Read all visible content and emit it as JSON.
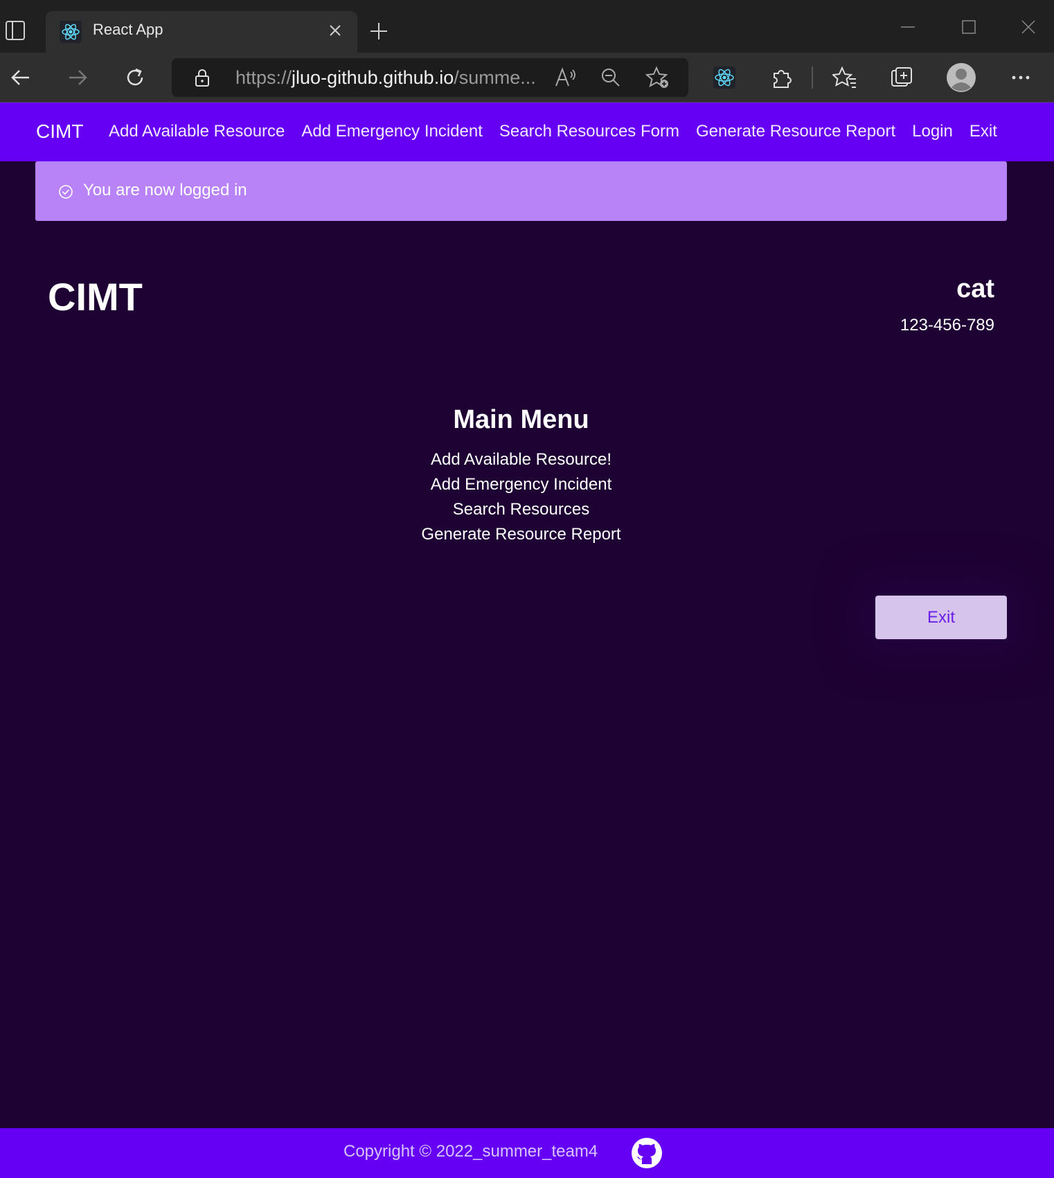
{
  "browser": {
    "tab_title": "React App",
    "url_scheme": "https://",
    "url_host": "jluo-github.github.io",
    "url_path": "/summe..."
  },
  "nav": {
    "brand": "CIMT",
    "links": [
      "Add Available Resource",
      "Add Emergency Incident",
      "Search Resources Form",
      "Generate Resource Report",
      "Login",
      "Exit"
    ]
  },
  "alert": {
    "message": "You are now logged in"
  },
  "header": {
    "logo": "CIMT",
    "user_name": "cat",
    "user_phone": "123-456-789"
  },
  "main_menu": {
    "title": "Main Menu",
    "items": [
      "Add Available Resource!",
      "Add Emergency Incident",
      "Search Resources",
      "Generate Resource Report"
    ]
  },
  "exit_button": {
    "label": "Exit"
  },
  "footer": {
    "copyright": "Copyright © 2022_summer_team4"
  },
  "colors": {
    "nav_bg": "#6600f5",
    "page_bg": "#1e0233",
    "alert_bg": "#b983f8",
    "button_bg": "#d6c4ec"
  }
}
